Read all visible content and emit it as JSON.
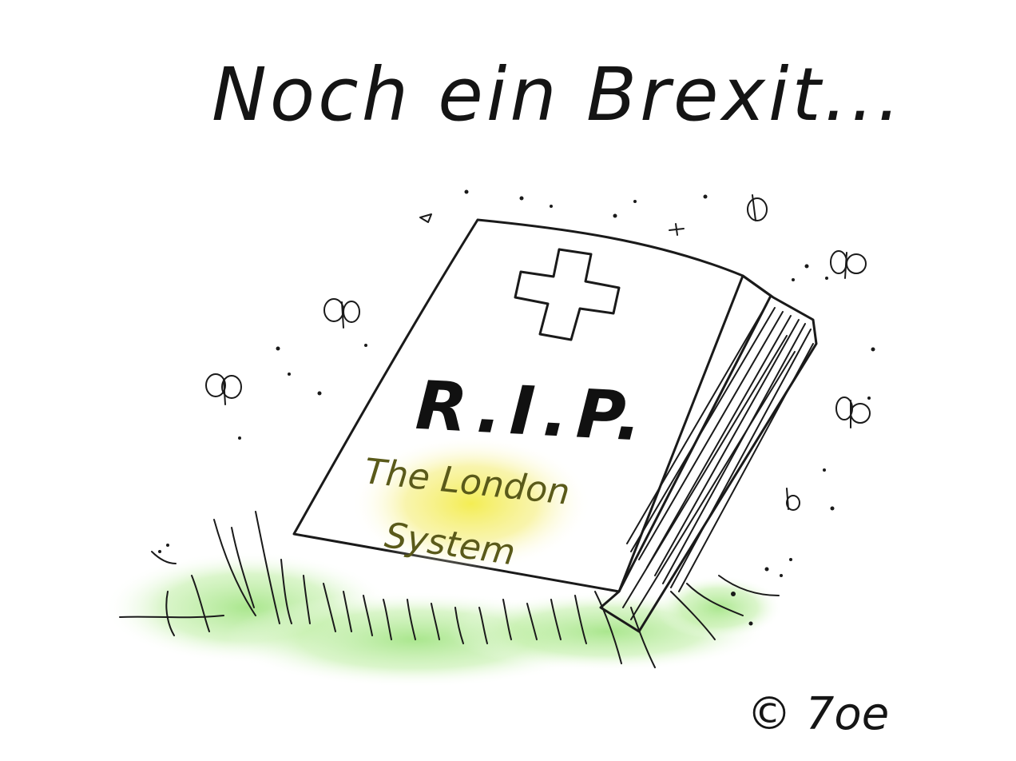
{
  "title": "Noch ein Brexit...",
  "gravestone": {
    "symbol": "cross",
    "inscription": "R.I.P.",
    "epitaph_line1": "The London",
    "epitaph_line2": "System"
  },
  "signature": "© 7oe",
  "colors": {
    "ink": "#1a1a1a",
    "cross_fill": "#cfcfcf",
    "highlight": "#f3ec6a",
    "grass": "#9be27a",
    "epitaph_ink": "#5a5a1a"
  },
  "decorations": [
    "butterfly",
    "grass",
    "dots"
  ]
}
